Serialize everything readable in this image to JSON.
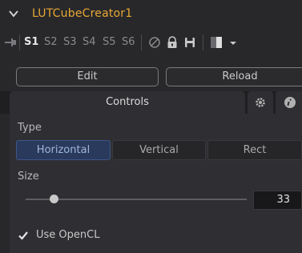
{
  "header": {
    "title": "LUTCubeCreator1"
  },
  "slots": {
    "items": [
      "S1",
      "S2",
      "S3",
      "S4",
      "S5",
      "S6"
    ],
    "active": "S1"
  },
  "toolbar": {
    "icons": [
      "disable-icon",
      "lock-icon",
      "save-icon",
      "color-swatch-icon",
      "dropdown-arrow-icon"
    ]
  },
  "actions": {
    "edit_label": "Edit",
    "reload_label": "Reload"
  },
  "tabs": {
    "controls_label": "Controls",
    "icons": [
      "gear-icon",
      "info-icon"
    ]
  },
  "controls": {
    "type_label": "Type",
    "type_options": [
      "Horizontal",
      "Vertical",
      "Rect"
    ],
    "type_selected": "Horizontal",
    "size_label": "Size",
    "size_value": "33",
    "use_opencl_label": "Use OpenCL",
    "use_opencl_checked": true
  },
  "colors": {
    "title": "#e8a733",
    "selected_segment": "#2a3a5c"
  }
}
